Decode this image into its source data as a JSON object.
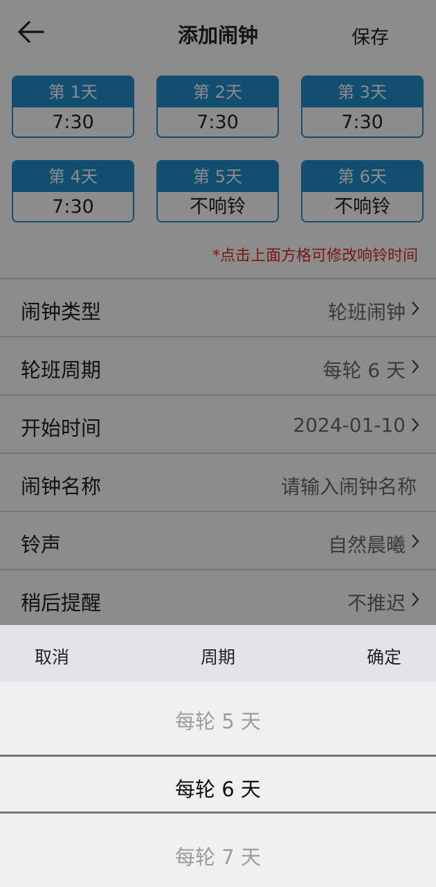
{
  "header": {
    "title": "添加闹钟",
    "save_label": "保存",
    "back_icon": "arrow-left-icon"
  },
  "days": [
    {
      "label": "第 1天",
      "time": "7:30"
    },
    {
      "label": "第 2天",
      "time": "7:30"
    },
    {
      "label": "第 3天",
      "time": "7:30"
    },
    {
      "label": "第 4天",
      "time": "7:30"
    },
    {
      "label": "第 5天",
      "time": "不响铃"
    },
    {
      "label": "第 6天",
      "time": "不响铃"
    }
  ],
  "hint": "*点击上面方格可修改响铃时间",
  "settings": [
    {
      "label": "闹钟类型",
      "value": "轮班闹钟"
    },
    {
      "label": "轮班周期",
      "value": "每轮 6 天"
    },
    {
      "label": "开始时间",
      "value": "2024-01-10"
    },
    {
      "label": "闹钟名称",
      "placeholder": "请输入闹钟名称"
    },
    {
      "label": "铃声",
      "value": "自然晨曦"
    },
    {
      "label": "稍后提醒",
      "value": "不推迟"
    }
  ],
  "picker": {
    "cancel_label": "取消",
    "title": "周期",
    "confirm_label": "确定",
    "options": [
      "每轮 5 天",
      "每轮 6 天",
      "每轮 7 天"
    ],
    "selected": "每轮 6 天"
  },
  "colors": {
    "accent": "#1f8ecd",
    "hint": "#e02b2b",
    "overlay": "rgba(0,0,0,0.45)"
  }
}
